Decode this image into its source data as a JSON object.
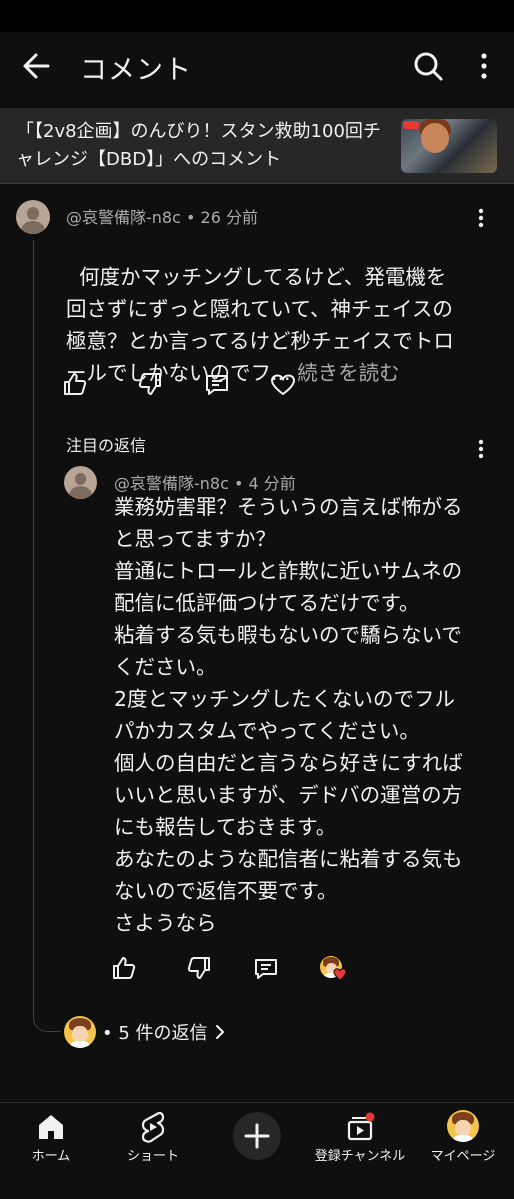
{
  "appbar": {
    "title": "コメント",
    "back_icon": "back-arrow-icon",
    "search_icon": "search-icon",
    "more_icon": "more-vert-icon"
  },
  "video": {
    "title": "「【2v8企画】のんびり！スタン救助100回チャレンジ【DBD】」へのコメント"
  },
  "comment": {
    "author": "@哀警備隊-n8c",
    "time": "26 分前",
    "separator": "•",
    "text": "何度かマッチングしてるけど、発電機を回さずにずっと隠れていて、神チェイスの極意？とか言ってるけど秒チェイスでトロールでしかないのでフ...",
    "more_label": "続きを読む"
  },
  "pinned": {
    "label": "注目の返信"
  },
  "reply": {
    "author": "@哀警備隊-n8c",
    "time": "4 分前",
    "separator": "•",
    "text": "業務妨害罪？そういうの言えば怖がると思ってますか？\n普通にトロールと詐欺に近いサムネの配信に低評価つけてるだけです。\n粘着する気も暇もないので驕らないでください。\n2度とマッチングしたくないのでフルパかカスタムでやってください。\n個人の自由だと言うなら好きにすればいいと思いますが、デドバの運営の方にも報告しておきます。\nあなたのような配信者に粘着する気もないので返信不要です。\nさようなら"
  },
  "replies_summary": {
    "dot": "•",
    "label": "5 件の返信"
  },
  "colors": {
    "background": "#0f0f0f",
    "header_band": "#272727",
    "text_primary": "#f1f1f1",
    "text_secondary": "#aaaaaa",
    "heart_red": "#e53935"
  },
  "nav": {
    "home": "ホーム",
    "shorts": "ショート",
    "subscriptions": "登録チャンネル",
    "mypage": "マイページ"
  }
}
